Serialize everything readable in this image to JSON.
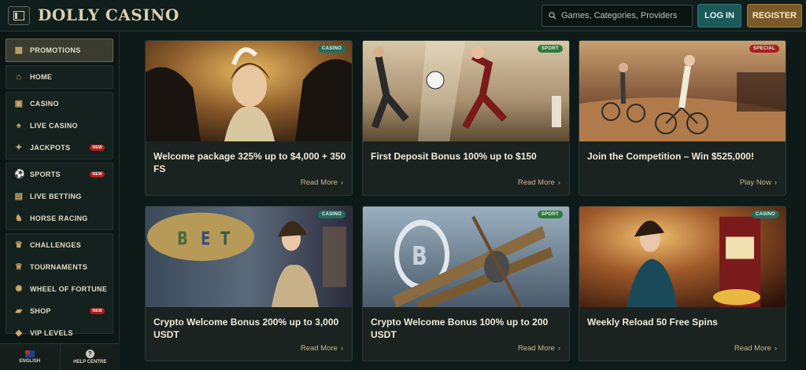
{
  "header": {
    "logo": "DOLLY CASINO",
    "search_placeholder": "Games, Categories, Providers",
    "login_label": "LOG IN",
    "register_label": "REGISTER"
  },
  "sidebar": {
    "promotions": "PROMOTIONS",
    "home": "HOME",
    "casino": "CASINO",
    "live_casino": "LIVE CASINO",
    "jackpots": "JACKPOTS",
    "sports": "SPORTS",
    "live_betting": "LIVE BETTING",
    "horse_racing": "HORSE RACING",
    "challenges": "CHALLENGES",
    "tournaments": "TOURNAMENTS",
    "wheel_of_fortune": "WHEEL OF FORTUNE",
    "shop": "SHOP",
    "vip_levels": "VIP LEVELS",
    "new_badge": "NEW",
    "footer_language": "ENGLISH",
    "footer_help": "HELP CENTRE",
    "help_glyph": "?"
  },
  "cards": [
    {
      "tag": "CASINO",
      "tag_color": "#1f6e5e",
      "title": "Welcome package 325% up to $4,000 + 350 FS",
      "link": "Read More"
    },
    {
      "tag": "SPORT",
      "tag_color": "#2c7a3a",
      "title": "First Deposit Bonus 100% up to $150",
      "link": "Read More"
    },
    {
      "tag": "SPECIAL",
      "tag_color": "#a41f1f",
      "title": "Join the Competition – Win $525,000!",
      "link": "Play Now"
    },
    {
      "tag": "CASINO",
      "tag_color": "#1f6e5e",
      "title": "Crypto Welcome Bonus 200% up to 3,000 USDT",
      "link": "Read More"
    },
    {
      "tag": "SPORT",
      "tag_color": "#2c7a3a",
      "title": "Crypto Welcome Bonus 100% up to 200 USDT",
      "link": "Read More"
    },
    {
      "tag": "CASINO",
      "tag_color": "#1f6e5e",
      "title": "Weekly Reload 50 Free Spins",
      "link": "Read More"
    }
  ],
  "colors": {
    "background": "#0d1a18",
    "accent_teal": "#1c5a5a",
    "accent_gold": "#7a5a2a"
  }
}
